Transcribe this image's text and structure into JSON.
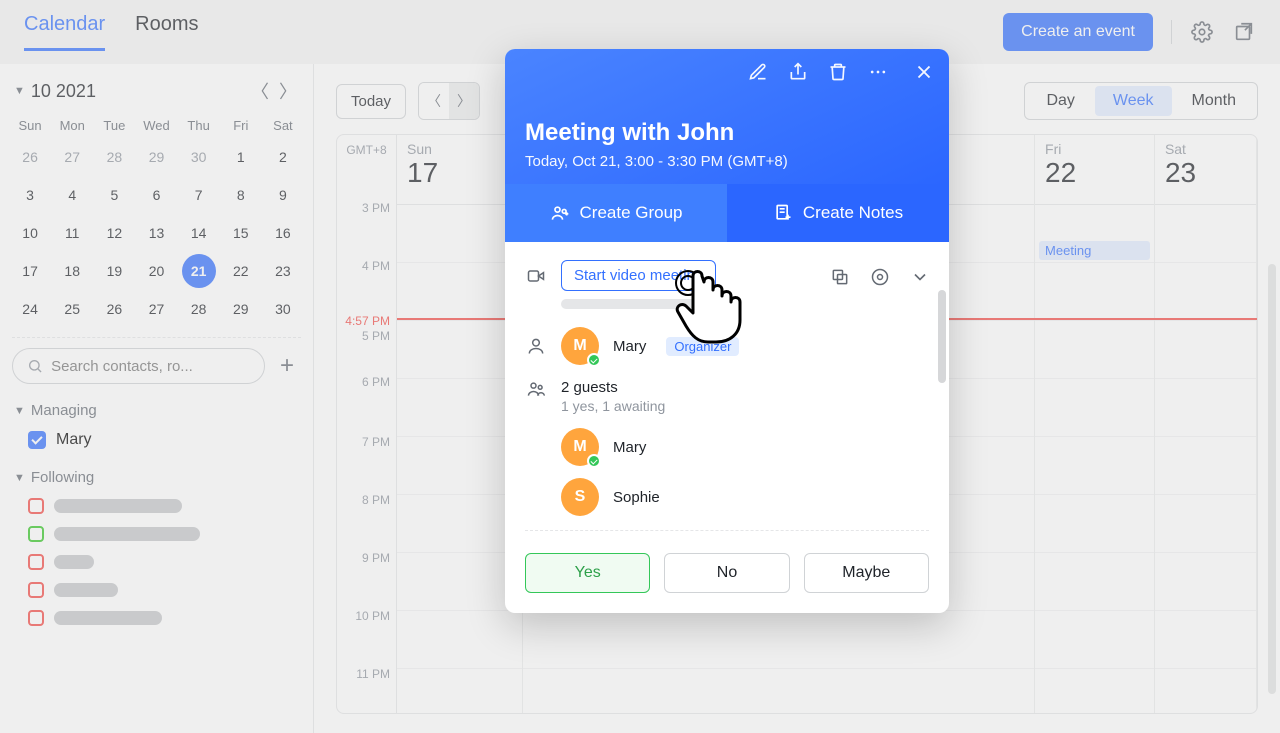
{
  "topbar": {
    "tab_calendar": "Calendar",
    "tab_rooms": "Rooms",
    "create_event": "Create an event"
  },
  "sidebar": {
    "month_label": "10 2021",
    "dow": [
      "Sun",
      "Mon",
      "Tue",
      "Wed",
      "Thu",
      "Fri",
      "Sat"
    ],
    "days": [
      {
        "n": "26",
        "dim": true
      },
      {
        "n": "27",
        "dim": true
      },
      {
        "n": "28",
        "dim": true
      },
      {
        "n": "29",
        "dim": true
      },
      {
        "n": "30",
        "dim": true
      },
      {
        "n": "1"
      },
      {
        "n": "2"
      },
      {
        "n": "3"
      },
      {
        "n": "4"
      },
      {
        "n": "5"
      },
      {
        "n": "6"
      },
      {
        "n": "7"
      },
      {
        "n": "8"
      },
      {
        "n": "9"
      },
      {
        "n": "10"
      },
      {
        "n": "11"
      },
      {
        "n": "12"
      },
      {
        "n": "13"
      },
      {
        "n": "14"
      },
      {
        "n": "15"
      },
      {
        "n": "16"
      },
      {
        "n": "17"
      },
      {
        "n": "18"
      },
      {
        "n": "19"
      },
      {
        "n": "20"
      },
      {
        "n": "21",
        "selected": true
      },
      {
        "n": "22"
      },
      {
        "n": "23"
      },
      {
        "n": "24"
      },
      {
        "n": "25"
      },
      {
        "n": "26"
      },
      {
        "n": "27"
      },
      {
        "n": "28"
      },
      {
        "n": "29"
      },
      {
        "n": "30"
      }
    ],
    "search_placeholder": "Search contacts, ro...",
    "section_managing": "Managing",
    "managing_item": "Mary",
    "section_following": "Following",
    "following_colors": [
      "#f54a45",
      "#34c724",
      "#f54a45",
      "#f54a45",
      "#f54a45"
    ],
    "following_widths": [
      128,
      146,
      40,
      64,
      108
    ]
  },
  "content": {
    "today_label": "Today",
    "view_day": "Day",
    "view_week": "Week",
    "view_month": "Month",
    "tz": "GMT+8",
    "time_labels": [
      "3 PM",
      "4 PM",
      "4:57 PM",
      "5 PM",
      "6 PM",
      "7 PM",
      "8 PM",
      "9 PM",
      "10 PM",
      "11 PM"
    ],
    "visible_days": [
      {
        "name": "Sun",
        "num": "17"
      },
      {
        "name": "Fri",
        "num": "22"
      },
      {
        "name": "Sat",
        "num": "23"
      }
    ],
    "event_chip": "Meeting"
  },
  "popup": {
    "title": "Meeting with John",
    "subtitle": "Today, Oct 21, 3:00 - 3:30 PM (GMT+8)",
    "create_group": "Create Group",
    "create_notes": "Create Notes",
    "start_video": "Start video meeting",
    "organizer_name": "Mary",
    "organizer_tag": "Organizer",
    "guests_count": "2 guests",
    "guests_status": "1 yes, 1 awaiting",
    "guests": [
      {
        "initial": "M",
        "name": "Mary",
        "accepted": true
      },
      {
        "initial": "S",
        "name": "Sophie",
        "accepted": false
      }
    ],
    "rsvp_yes": "Yes",
    "rsvp_no": "No",
    "rsvp_maybe": "Maybe"
  }
}
